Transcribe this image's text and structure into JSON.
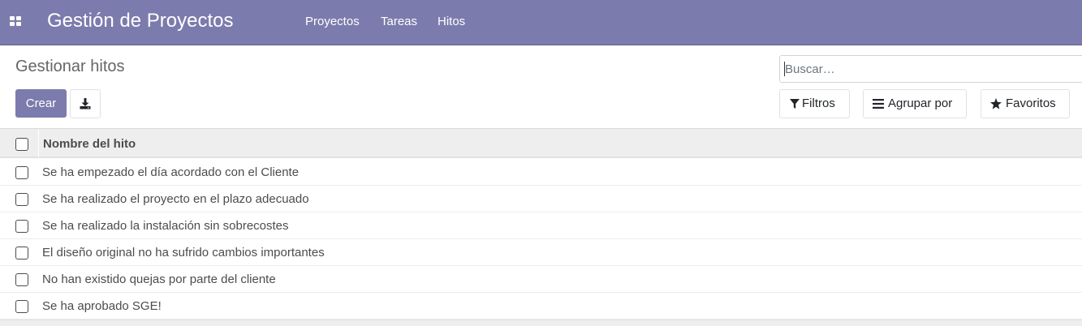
{
  "navbar": {
    "app_title": "Gestión de Proyectos",
    "menu": [
      {
        "label": "Proyectos"
      },
      {
        "label": "Tareas"
      },
      {
        "label": "Hitos"
      }
    ],
    "color": "#7c7bad"
  },
  "control_panel": {
    "title": "Gestionar hitos",
    "create_label": "Crear",
    "export_icon": "download-icon",
    "search_placeholder": "Buscar…",
    "filters_label": "Filtros",
    "group_by_label": "Agrupar por",
    "favorites_label": "Favoritos"
  },
  "list": {
    "column_header": "Nombre del hito",
    "rows": [
      {
        "name": "Se ha empezado el día acordado con el Cliente"
      },
      {
        "name": "Se ha realizado el proyecto en el plazo adecuado"
      },
      {
        "name": "Se ha realizado la instalación sin sobrecostes"
      },
      {
        "name": "El diseño original no ha sufrido cambios importantes"
      },
      {
        "name": "No han existido quejas por parte del cliente"
      },
      {
        "name": "Se ha aprobado SGE!"
      }
    ]
  }
}
